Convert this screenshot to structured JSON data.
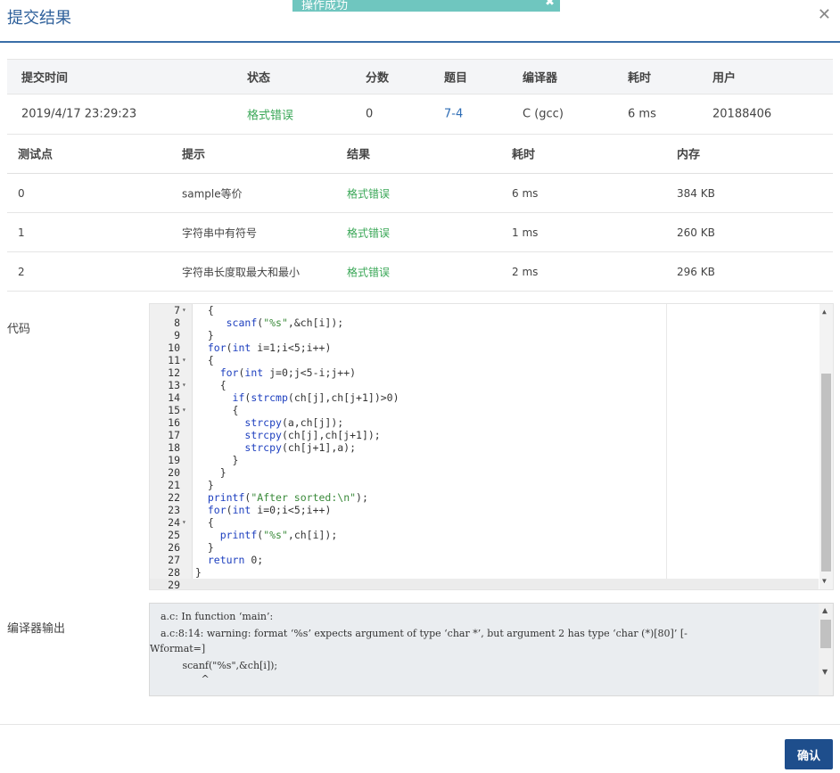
{
  "dialog": {
    "title": "提交结果",
    "close_icon": "close-icon"
  },
  "toast": {
    "message": "操作成功",
    "close_icon": "close-icon"
  },
  "summary": {
    "headers": [
      "提交时间",
      "状态",
      "分数",
      "题目",
      "编译器",
      "耗时",
      "用户"
    ],
    "row": {
      "time": "2019/4/17 23:29:23",
      "status": "格式错误",
      "score": "0",
      "problem": "7-4",
      "compiler": "C (gcc)",
      "elapsed": "6 ms",
      "user": "20188406"
    }
  },
  "tests": {
    "headers": [
      "测试点",
      "提示",
      "结果",
      "耗时",
      "内存"
    ],
    "rows": [
      {
        "id": "0",
        "hint": "sample等价",
        "result": "格式错误",
        "time": "6 ms",
        "memory": "384 KB"
      },
      {
        "id": "1",
        "hint": "字符串中有符号",
        "result": "格式错误",
        "time": "1 ms",
        "memory": "260 KB"
      },
      {
        "id": "2",
        "hint": "字符串长度取最大和最小",
        "result": "格式错误",
        "time": "2 ms",
        "memory": "296 KB"
      }
    ]
  },
  "code": {
    "label": "代码",
    "lines": [
      {
        "n": "7",
        "fold": "▾",
        "text": "  {"
      },
      {
        "n": "8",
        "fold": "",
        "text": "     scanf(\"%s\",&ch[i]);"
      },
      {
        "n": "9",
        "fold": "",
        "text": "  }"
      },
      {
        "n": "10",
        "fold": "",
        "text": "  for(int i=1;i<5;i++)"
      },
      {
        "n": "11",
        "fold": "▾",
        "text": "  {"
      },
      {
        "n": "12",
        "fold": "",
        "text": "    for(int j=0;j<5-i;j++)"
      },
      {
        "n": "13",
        "fold": "▾",
        "text": "    {"
      },
      {
        "n": "14",
        "fold": "",
        "text": "      if(strcmp(ch[j],ch[j+1])>0)"
      },
      {
        "n": "15",
        "fold": "▾",
        "text": "      {"
      },
      {
        "n": "16",
        "fold": "",
        "text": "        strcpy(a,ch[j]);"
      },
      {
        "n": "17",
        "fold": "",
        "text": "        strcpy(ch[j],ch[j+1]);"
      },
      {
        "n": "18",
        "fold": "",
        "text": "        strcpy(ch[j+1],a);"
      },
      {
        "n": "19",
        "fold": "",
        "text": "      }"
      },
      {
        "n": "20",
        "fold": "",
        "text": "    }"
      },
      {
        "n": "21",
        "fold": "",
        "text": "  }"
      },
      {
        "n": "22",
        "fold": "",
        "text": "  printf(\"After sorted:\\n\");"
      },
      {
        "n": "23",
        "fold": "",
        "text": "  for(int i=0;i<5;i++)"
      },
      {
        "n": "24",
        "fold": "▾",
        "text": "  {"
      },
      {
        "n": "25",
        "fold": "",
        "text": "    printf(\"%s\",ch[i]);"
      },
      {
        "n": "26",
        "fold": "",
        "text": "  }"
      },
      {
        "n": "27",
        "fold": "",
        "text": "  return 0;"
      },
      {
        "n": "28",
        "fold": "",
        "text": "}"
      },
      {
        "n": "29",
        "fold": "",
        "text": ""
      }
    ]
  },
  "compiler_output": {
    "label": "编译器输出",
    "lines": [
      "a.c: In function ‘main’:",
      "a.c:8:14: warning: format ‘%s’ expects argument of type ‘char *’, but argument 2 has type ‘char (*)[80]’ [-",
      "Wformat=]",
      "       scanf(\"%s\",&ch[i]);",
      "             ^"
    ]
  },
  "footer": {
    "ok_label": "确认"
  }
}
